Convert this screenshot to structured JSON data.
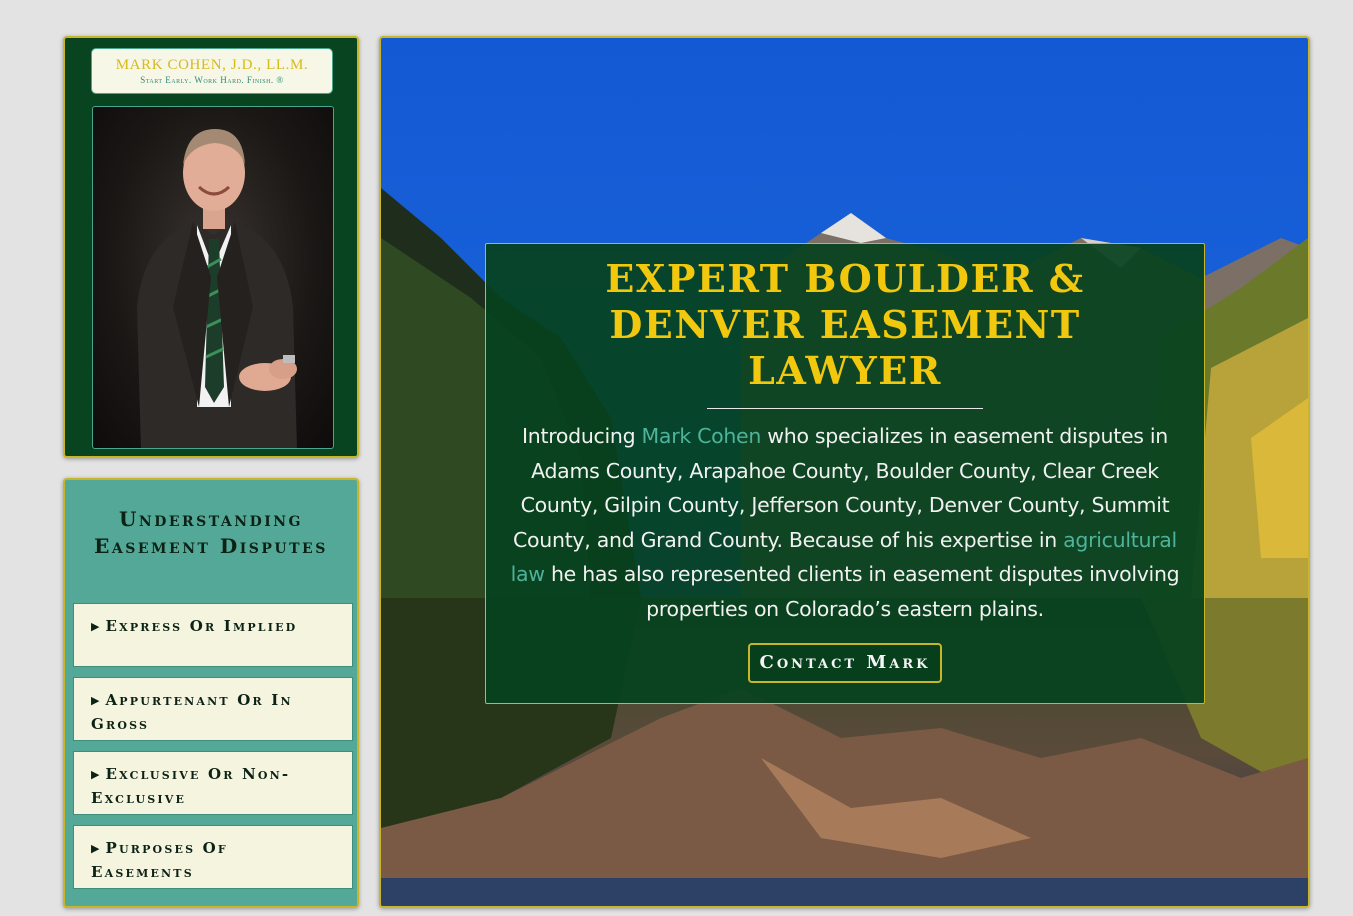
{
  "logo": {
    "name": "MARK COHEN, J.D., LL.M.",
    "tagline": "Start Early. Work Hard. Finish. ®"
  },
  "sidebar": {
    "title": "Understanding Easement Disputes",
    "items": [
      {
        "label": "Express Or Implied"
      },
      {
        "label": "Appurtenant Or In Gross"
      },
      {
        "label": "Exclusive Or Non-Exclusive"
      },
      {
        "label": "Purposes Of Easements"
      }
    ]
  },
  "hero": {
    "title": "EXPERT BOULDER & DENVER EASEMENT LAWYER",
    "text_intro": "Introducing ",
    "link_name": "Mark Cohen",
    "text_mid": " who specializes in easement disputes in Adams County, Arapahoe County, Boulder County, Clear Creek County, Gilpin County, Jefferson County, Denver County, Summit County, and Grand County. Because of his expertise in ",
    "link_law": "agricultural law",
    "text_end": " he has also represented clients in easement disputes involving properties on Colorado’s eastern plains.",
    "button": "Contact Mark"
  },
  "colors": {
    "dark_green": "#07441f",
    "gold": "#f2c80f",
    "teal": "#54a897",
    "link": "#4fb39c",
    "page_bg": "#e3e3e3"
  },
  "icons": {
    "accordion": "triangle-right-icon"
  }
}
